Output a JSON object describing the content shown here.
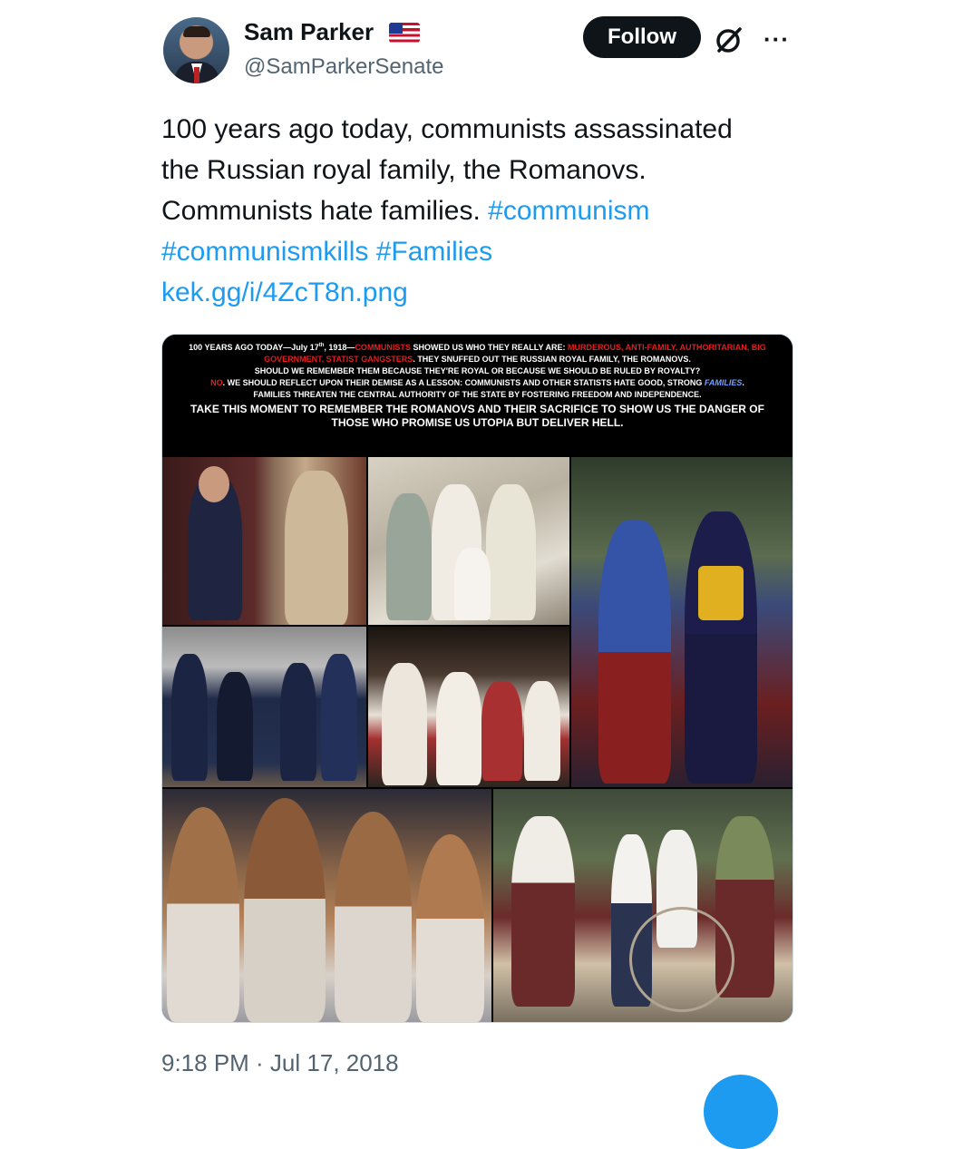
{
  "author": {
    "name": "Sam Parker",
    "handle": "@SamParkerSenate",
    "flag_icon": "us-flag-icon"
  },
  "header": {
    "follow_label": "Follow",
    "more_label": "···",
    "grok_icon": "grok-icon"
  },
  "tweet": {
    "text_line1": "100 years ago today, communists assassinated",
    "text_line2": "the Russian royal family, the Romanovs.",
    "text_line3": "Communists hate families.",
    "hashtag1": "#communism",
    "hashtag2": "#communismkills",
    "hashtag3": "#Families",
    "link": "kek.gg/i/4ZcT8n.png"
  },
  "media": {
    "banner": {
      "line1_a": "100 YEARS AGO TODAY—July 17",
      "line1_sup": "th",
      "line1_b": ", 1918—",
      "line1_red1": "COMMUNISTS",
      "line1_c": " SHOWED US WHO THEY REALLY ARE: ",
      "line1_red2": "MURDEROUS, ANTI-FAMILY, AUTHORITARIAN, BIG GOVERNMENT, STATIST GANGSTERS",
      "line1_d": ". THEY SNUFFED OUT THE RUSSIAN ROYAL FAMILY, THE ROMANOVS.",
      "line2": "SHOULD WE REMEMBER THEM BECAUSE THEY'RE ROYAL OR BECAUSE WE SHOULD BE RULED BY ROYALTY?",
      "line3_red": "NO",
      "line3_a": ". WE SHOULD REFLECT UPON THEIR DEMISE AS A LESSON: COMMUNISTS AND OTHER STATISTS HATE GOOD, STRONG ",
      "line3_blue": "FAMILIES",
      "line3_b": ".",
      "line4": "FAMILIES THREATEN THE CENTRAL AUTHORITY OF THE STATE BY FOSTERING FREEDOM AND INDEPENDENCE.",
      "line5": "TAKE THIS MOMENT TO REMEMBER THE ROMANOVS AND THEIR SACRIFICE TO SHOW US THE DANGER OF THOSE WHO PROMISE US UTOPIA BUT DELIVER HELL."
    }
  },
  "timestamp": "9:18 PM · Jul 17, 2018",
  "colors": {
    "link": "#1d9bf0",
    "text": "#0f1419",
    "muted": "#536471",
    "banner_red": "#e51d1d"
  }
}
